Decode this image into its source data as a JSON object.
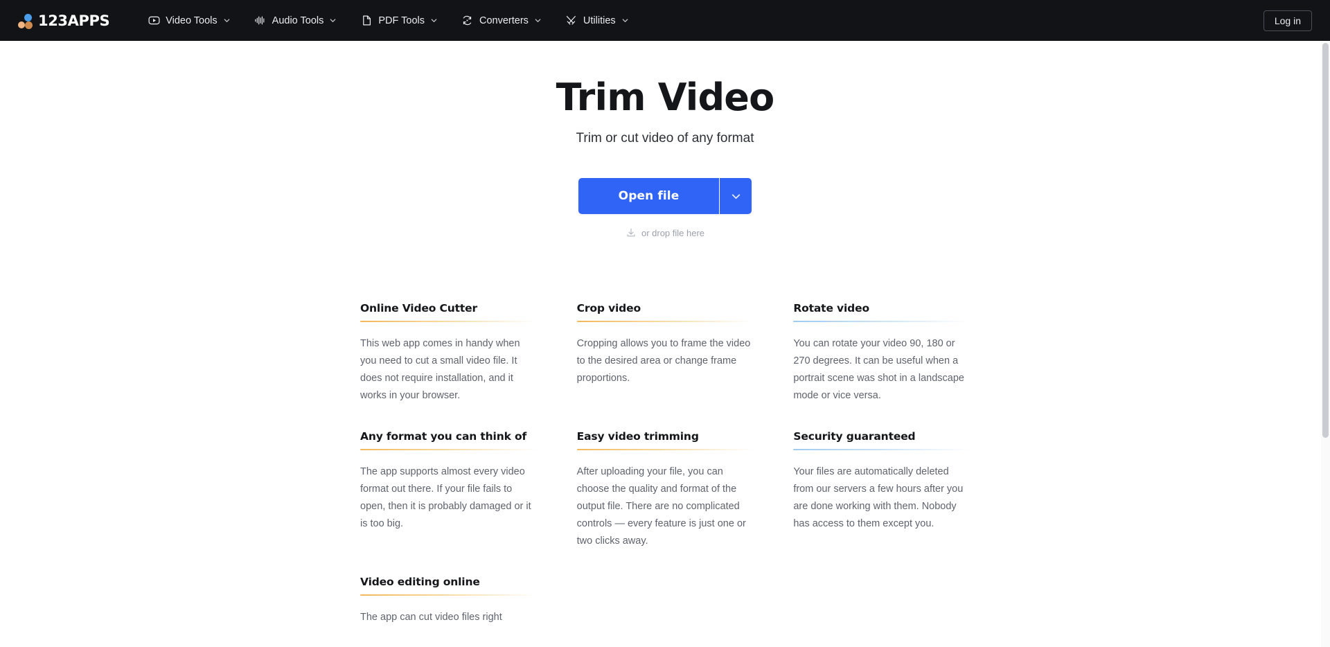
{
  "nav": {
    "logo_text": "123APPS",
    "logo_icon": "three-dots-logo",
    "items": [
      {
        "label": "Video Tools",
        "icon": "video-play-icon",
        "caret": "chevron-down-icon"
      },
      {
        "label": "Audio Tools",
        "icon": "audio-waveform-icon",
        "caret": "chevron-down-icon"
      },
      {
        "label": "PDF Tools",
        "icon": "document-page-icon",
        "caret": "chevron-down-icon"
      },
      {
        "label": "Converters",
        "icon": "circular-arrows-icon",
        "caret": "chevron-down-icon"
      },
      {
        "label": "Utilities",
        "icon": "crossed-tools-icon",
        "caret": "chevron-down-icon"
      }
    ],
    "login_label": "Log in"
  },
  "hero": {
    "title": "Trim Video",
    "subtitle": "Trim or cut video of any format",
    "open_file_label": "Open file",
    "open_file_caret_icon": "chevron-down-icon",
    "drop_hint": "or drop file here",
    "drop_icon": "download-arrow-icon"
  },
  "colors": {
    "accent_blue": "#2f64f7",
    "nav_background": "#111317",
    "rule_amber": "#f3b85a",
    "rule_blue": "#9fcbef",
    "logo_dot_blue": "#4a9de8",
    "logo_dot_tan": "#f0b480",
    "logo_dot_brown": "#d08a4e"
  },
  "features": [
    {
      "title": "Online Video Cutter",
      "rule": "amber",
      "body": "This web app comes in handy when you need to cut a small video file. It does not require installation, and it works in your browser."
    },
    {
      "title": "Crop video",
      "rule": "amber",
      "body": "Cropping allows you to frame the video to the desired area or change frame proportions."
    },
    {
      "title": "Rotate video",
      "rule": "blue",
      "body": "You can rotate your video 90, 180 or 270 degrees. It can be useful when a portrait scene was shot in a landscape mode or vice versa."
    },
    {
      "title": "Any format you can think of",
      "rule": "amber",
      "body": "The app supports almost every video format out there. If your file fails to open, then it is probably damaged or it is too big."
    },
    {
      "title": "Easy video trimming",
      "rule": "amber",
      "body": "After uploading your file, you can choose the quality and format of the output file. There are no complicated controls — every feature is just one or two clicks away."
    },
    {
      "title": "Security guaranteed",
      "rule": "blue",
      "body": "Your files are automatically deleted from our servers a few hours after you are done working with them. Nobody has access to them except you."
    },
    {
      "title": "Video editing online",
      "rule": "amber",
      "body": "The app can cut video files right"
    }
  ]
}
